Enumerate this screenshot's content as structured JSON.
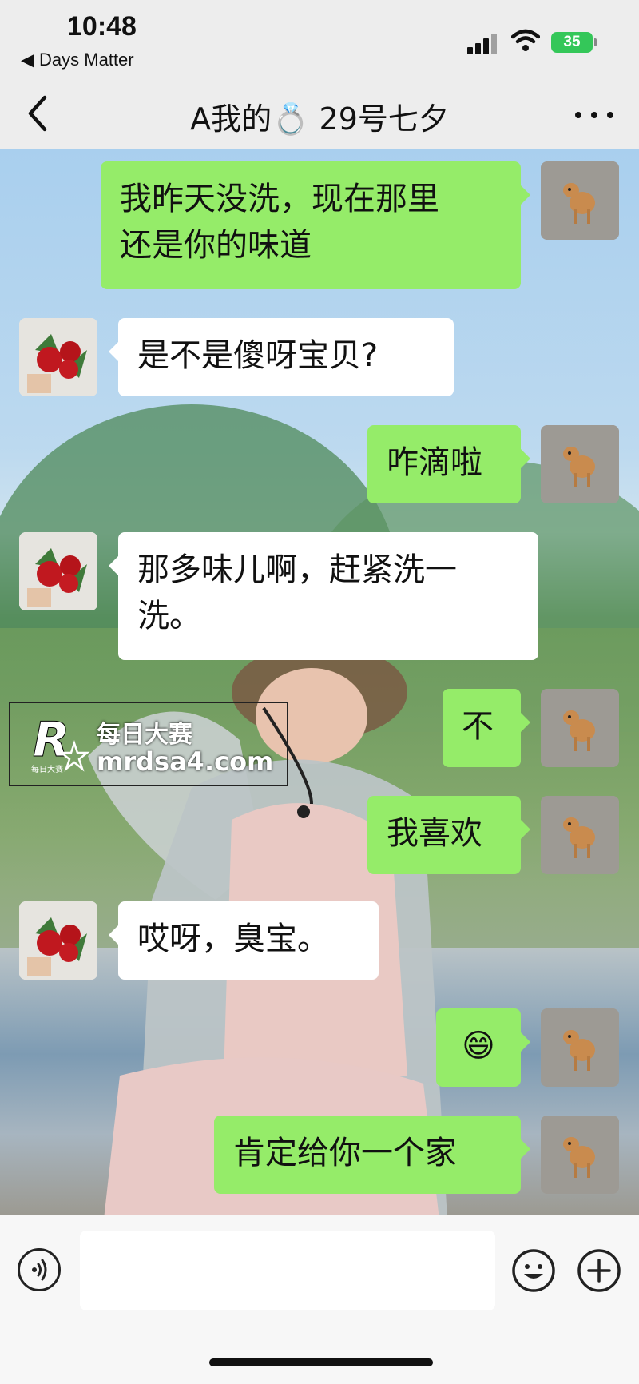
{
  "status_bar": {
    "time": "10:48",
    "back_app": "◀ Days Matter",
    "battery": "35"
  },
  "nav": {
    "title": "A我的💍 29号七夕"
  },
  "messages": [
    {
      "side": "mine",
      "text": "我昨天没洗，现在那里\n还是你的味道"
    },
    {
      "side": "theirs",
      "text": "是不是傻呀宝贝?"
    },
    {
      "side": "mine",
      "text": "咋滴啦"
    },
    {
      "side": "theirs",
      "text": "那多味儿啊，赶紧洗一\n洗。"
    },
    {
      "side": "mine",
      "text": "不"
    },
    {
      "side": "mine",
      "text": "我喜欢"
    },
    {
      "side": "theirs",
      "text": "哎呀，臭宝。"
    },
    {
      "side": "mine",
      "text": "😄"
    },
    {
      "side": "mine",
      "text": "肯定给你一个家"
    }
  ],
  "watermark": {
    "line1": "每日大赛",
    "line2": "mrdsa4.com",
    "logo_letter": "R",
    "logo_sub": "每日大赛"
  },
  "input": {
    "placeholder": ""
  },
  "icons": {
    "back": "chevron-left-icon",
    "more": "more-dots-icon",
    "voice": "voice-icon",
    "emoji": "emoji-icon",
    "plus": "plus-icon"
  },
  "colors": {
    "my_bubble": "#95ec69",
    "their_bubble": "#ffffff",
    "battery": "#34c759"
  }
}
